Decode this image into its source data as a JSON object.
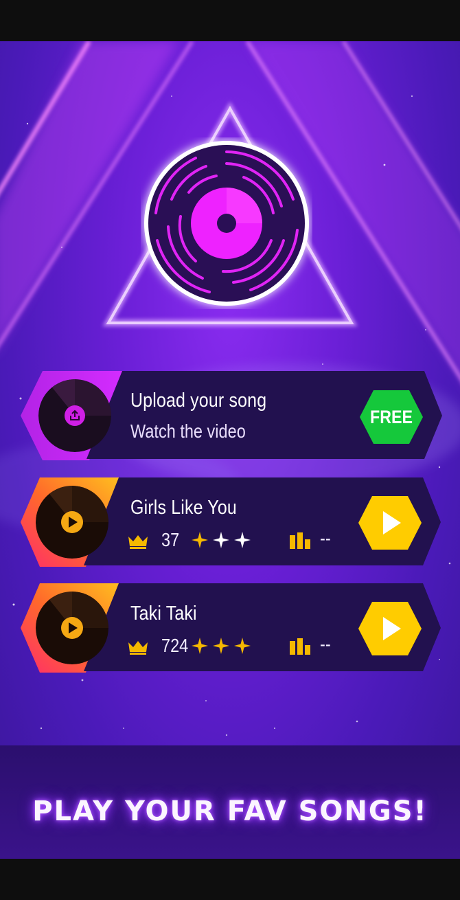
{
  "colors": {
    "background_top": "#8a2cf0",
    "background_bottom": "#3a179a",
    "card_bg": "#22114f",
    "free_button": "#15c83b",
    "play_button": "#ffcc00",
    "accent_magenta": "#e022ff",
    "accent_gold": "#f5b800"
  },
  "hero": {
    "icon": "vinyl-disc-icon"
  },
  "upload_card": {
    "title": "Upload your song",
    "subtitle": "Watch the video",
    "button_label": "FREE",
    "thumb_icon": "upload-icon"
  },
  "songs": [
    {
      "title": "Girls Like You",
      "crowns": "37",
      "stars_filled": 1,
      "stars_total": 3,
      "rank": "--"
    },
    {
      "title": "Taki Taki",
      "crowns": "724",
      "stars_filled": 3,
      "stars_total": 3,
      "rank": "--"
    }
  ],
  "banner": {
    "text": "PLAY YOUR FAV SONGS!"
  }
}
